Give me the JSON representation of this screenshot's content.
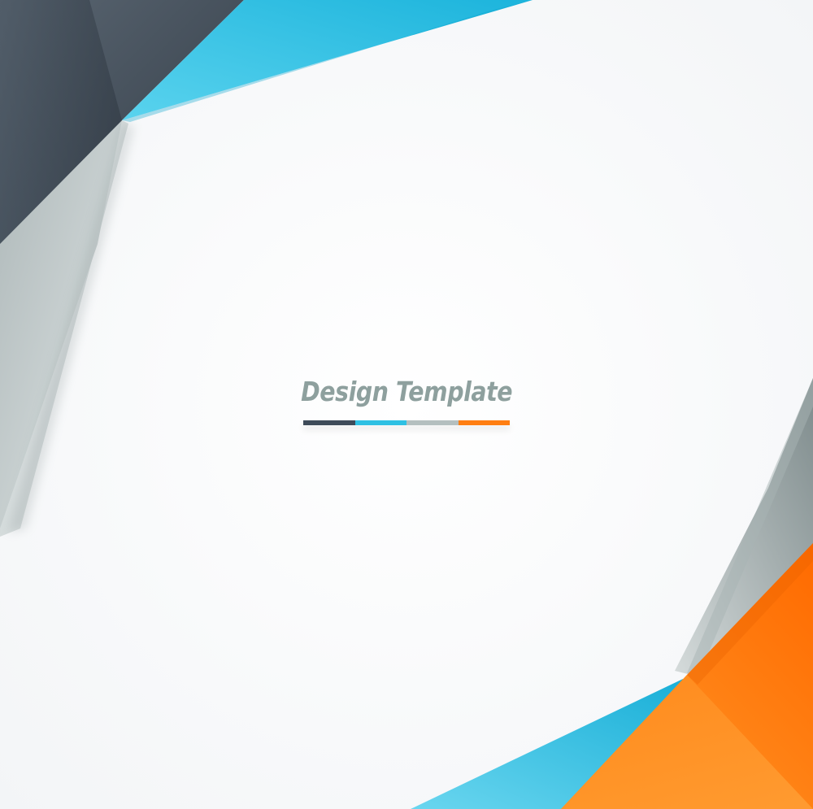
{
  "title": "Design Template",
  "palette": {
    "dark": "#3e4b59",
    "blue": "#2ec0e3",
    "gray": "#b4bfbf",
    "orange": "#ff7e12",
    "title_color": "#8ea09e",
    "background": "#ffffff"
  },
  "color_bar": [
    {
      "name": "dark",
      "color": "#3e4b59"
    },
    {
      "name": "blue",
      "color": "#2ec0e3"
    },
    {
      "name": "gray",
      "color": "#b4bfbf"
    },
    {
      "name": "orange",
      "color": "#ff7e12"
    }
  ]
}
